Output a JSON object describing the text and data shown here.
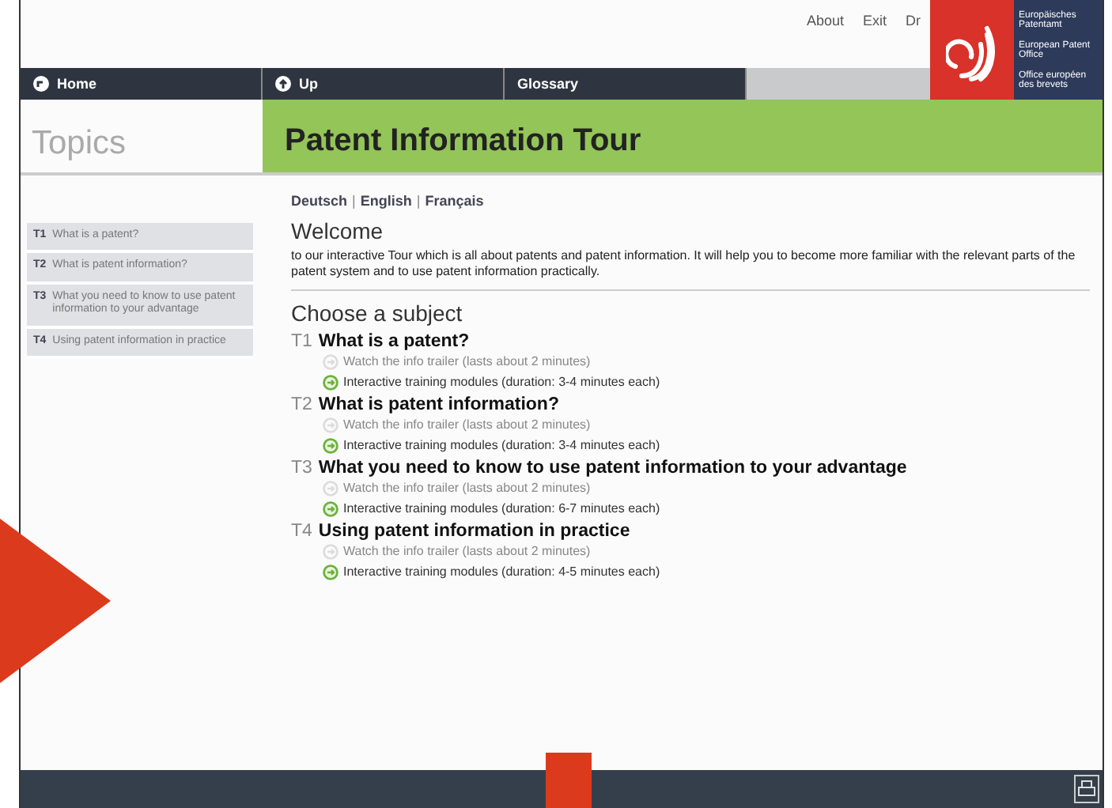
{
  "top_links": [
    {
      "label": "About"
    },
    {
      "label": "Exit"
    },
    {
      "label": "Dr"
    }
  ],
  "logo_text": [
    "Europäisches Patentamt",
    "European Patent Office",
    "Office européen des brevets"
  ],
  "nav": [
    {
      "label": "Home"
    },
    {
      "label": "Up"
    },
    {
      "label": "Glossary"
    }
  ],
  "sidebar": {
    "title": "Topics",
    "items": [
      {
        "code": "T1",
        "label": "What is a patent?"
      },
      {
        "code": "T2",
        "label": "What is patent information?"
      },
      {
        "code": "T3",
        "label": "What you need to know to use patent information to your advantage"
      },
      {
        "code": "T4",
        "label": "Using patent information in practice"
      }
    ]
  },
  "header": "Patent Information Tour",
  "languages": [
    {
      "kind": "link",
      "text": "Deutsch"
    },
    {
      "kind": "separator",
      "text": "|"
    },
    {
      "kind": "link",
      "text": "English"
    },
    {
      "kind": "separator",
      "text": "|"
    },
    {
      "kind": "link",
      "text": "Français"
    }
  ],
  "welcome": {
    "title": "Welcome",
    "text": "to our interactive Tour which is all about patents and patent information. It will help you to become more familiar with the relevant parts of the patent system and to use patent information practically."
  },
  "subjects_title": "Choose a subject",
  "subjects": [
    {
      "code": "T1",
      "title": "What is a patent?",
      "links": [
        {
          "label": "Watch the info trailer (lasts about 2 minutes)",
          "available": false
        },
        {
          "label": "Interactive training modules (duration: 3-4 minutes each)",
          "available": true
        }
      ]
    },
    {
      "code": "T2",
      "title": "What is patent information?",
      "links": [
        {
          "label": "Watch the info trailer (lasts about 2 minutes)",
          "available": false
        },
        {
          "label": "Interactive training modules (duration: 3-4 minutes each)",
          "available": true
        }
      ]
    },
    {
      "code": "T3",
      "title": "What you need to know to use patent information to your advantage",
      "links": [
        {
          "label": "Watch the info trailer (lasts about 2 minutes)",
          "available": false
        },
        {
          "label": "Interactive training modules (duration: 6-7 minutes each)",
          "available": true
        }
      ]
    },
    {
      "code": "T4",
      "title": "Using patent information in practice",
      "links": [
        {
          "label": "Watch the info trailer (lasts about 2 minutes)",
          "available": false
        },
        {
          "label": "Interactive training modules (duration: 4-5 minutes each)",
          "available": true
        }
      ]
    }
  ]
}
